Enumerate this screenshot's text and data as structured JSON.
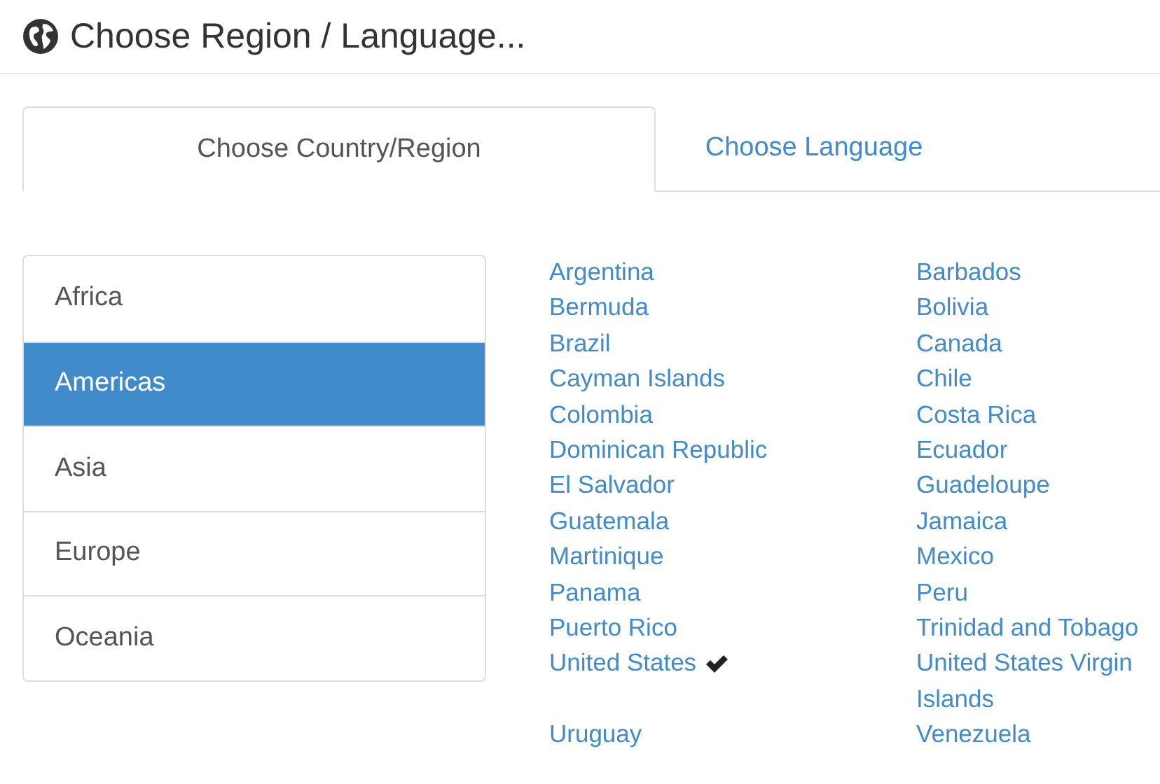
{
  "title": "Choose Region / Language...",
  "tabs": [
    {
      "label": "Choose Country/Region",
      "selected": true
    },
    {
      "label": "Choose Language",
      "selected": false
    }
  ],
  "regions": [
    {
      "label": "Africa",
      "selected": false
    },
    {
      "label": "Americas",
      "selected": true
    },
    {
      "label": "Asia",
      "selected": false
    },
    {
      "label": "Europe",
      "selected": false
    },
    {
      "label": "Oceania",
      "selected": false
    }
  ],
  "countries": [
    {
      "label": "Argentina",
      "selected": false
    },
    {
      "label": "Barbados",
      "selected": false
    },
    {
      "label": "Bermuda",
      "selected": false
    },
    {
      "label": "Bolivia",
      "selected": false
    },
    {
      "label": "Brazil",
      "selected": false
    },
    {
      "label": "Canada",
      "selected": false
    },
    {
      "label": "Cayman Islands",
      "selected": false
    },
    {
      "label": "Chile",
      "selected": false
    },
    {
      "label": "Colombia",
      "selected": false
    },
    {
      "label": "Costa Rica",
      "selected": false
    },
    {
      "label": "Dominican Republic",
      "selected": false
    },
    {
      "label": "Ecuador",
      "selected": false
    },
    {
      "label": "El Salvador",
      "selected": false
    },
    {
      "label": "Guadeloupe",
      "selected": false
    },
    {
      "label": "Guatemala",
      "selected": false
    },
    {
      "label": "Jamaica",
      "selected": false
    },
    {
      "label": "Martinique",
      "selected": false
    },
    {
      "label": "Mexico",
      "selected": false
    },
    {
      "label": "Panama",
      "selected": false
    },
    {
      "label": "Peru",
      "selected": false
    },
    {
      "label": "Puerto Rico",
      "selected": false
    },
    {
      "label": "Trinidad and Tobago",
      "selected": false
    },
    {
      "label": "United States",
      "selected": true
    },
    {
      "label": "United States Virgin Islands",
      "selected": false
    },
    {
      "label": "Uruguay",
      "selected": false
    },
    {
      "label": "Venezuela",
      "selected": false
    }
  ]
}
